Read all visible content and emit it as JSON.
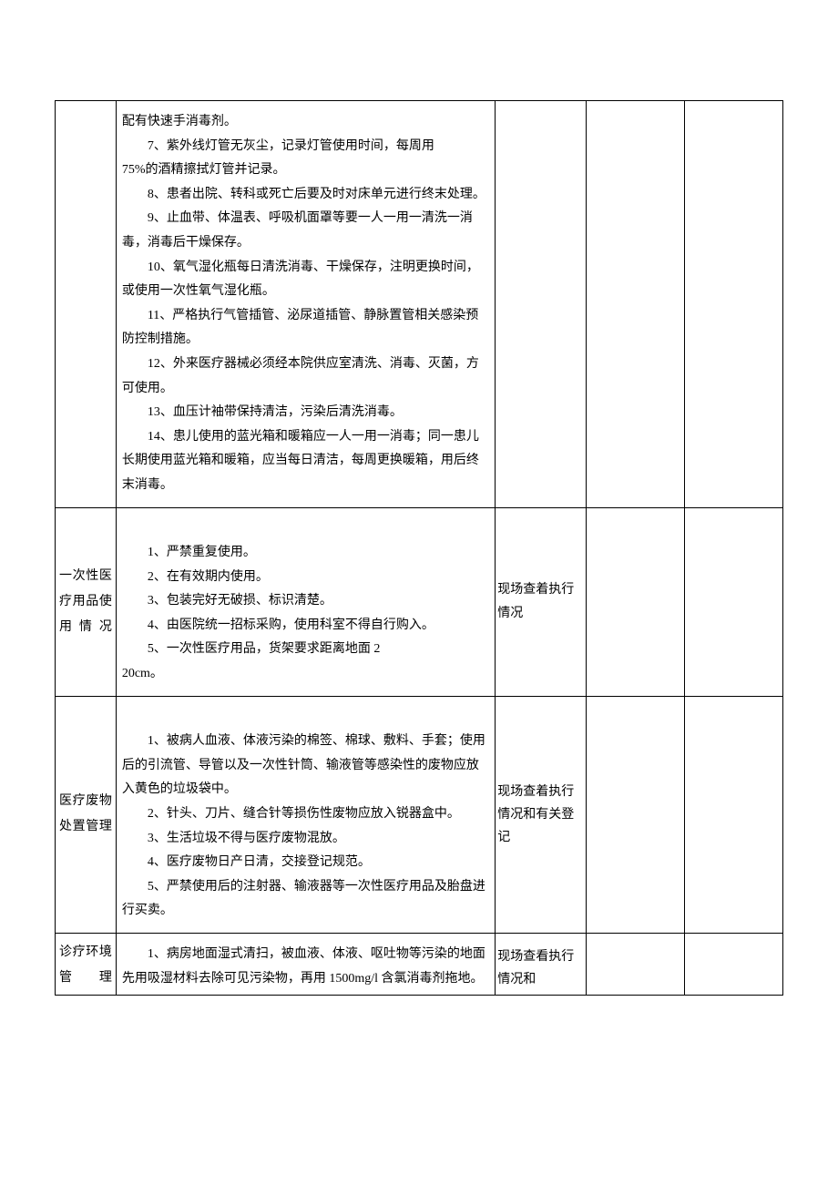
{
  "rows": [
    {
      "label": "",
      "content": [
        "配有快速手消毒剂。",
        "7、紫外线灯管无灰尘，记录灯管使用时间，每周用",
        "75%的酒精擦拭灯管并记录。",
        "8、患者出院、转科或死亡后要及时对床单元进行终末处理。",
        "9、止血带、体温表、呼吸机面罩等要一人一用一清洗一消毒，消毒后干燥保存。",
        "10、氧气湿化瓶每日清洗消毒、干燥保存，注明更换时间，或使用一次性氧气湿化瓶。",
        "11、严格执行气管插管、泌尿道插管、静脉置管相关感染预防控制措施。",
        "12、外来医疗器械必须经本院供应室清洗、消毒、灭菌，方可使用。",
        "13、血压计袖带保持清洁，污染后清洗消毒。",
        "14、患儿使用的蓝光箱和暖箱应一人一用一消毒；同一患儿长期使用蓝光箱和暖箱，应当每日清洁，每周更换暖箱，用后终末消毒。"
      ],
      "check": ""
    },
    {
      "label": "一次性医疗用品使用情况",
      "content": [
        "1、严禁重复使用。",
        "2、在有效期内使用。",
        "3、包装完好无破损、标识清楚。",
        "4、由医院统一招标采购，使用科室不得自行购入。",
        "5、一次性医疗用品，货架要求距离地面 2",
        "20cm。"
      ],
      "check": "现场查着执行情况"
    },
    {
      "label": "医疗废物处置管理",
      "content": [
        "1、被病人血液、体液污染的棉签、棉球、敷料、手套；使用后的引流管、导管以及一次性针筒、输液管等感染性的废物应放入黄色的垃圾袋中。",
        "2、针头、刀片、缝合针等损伤性废物应放入锐器盒中。",
        "3、生活垃圾不得与医疗废物混放。",
        "4、医疗废物日产日清，交接登记规范。",
        "5、严禁使用后的注射器、输液器等一次性医疗用品及胎盘进行买卖。"
      ],
      "check": "现场查着执行情况和有关登记"
    },
    {
      "label": "诊疗环境管理",
      "content": [
        "1、病房地面湿式清扫，被血液、体液、呕吐物等污染的地面先用吸湿材料去除可见污染物，再用 1500mg/l 含氯消毒剂拖地。"
      ],
      "check": "现场查看执行情况和"
    }
  ]
}
